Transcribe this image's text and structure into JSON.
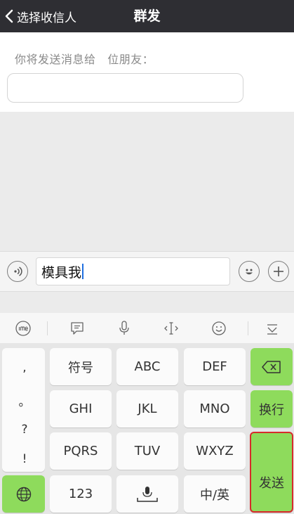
{
  "nav": {
    "back_label": "选择收信人",
    "title": "群发"
  },
  "recipients": {
    "text": "你将发送消息给   位朋友："
  },
  "input": {
    "value": "模具我"
  },
  "keyboard": {
    "punctuation": [
      ",",
      "。",
      "?",
      "!"
    ],
    "row1": [
      "符号",
      "ABC",
      "DEF"
    ],
    "row2": [
      "GHI",
      "JKL",
      "MNO"
    ],
    "row3": [
      "PQRS",
      "TUV",
      "WXYZ"
    ],
    "row4": [
      "123",
      "中/英"
    ],
    "newline_label": "换行",
    "send_label": "发送"
  },
  "colors": {
    "nav_bg": "#2e2e33",
    "accent_green": "#8edb5c",
    "highlight_red": "#d62b2b"
  }
}
